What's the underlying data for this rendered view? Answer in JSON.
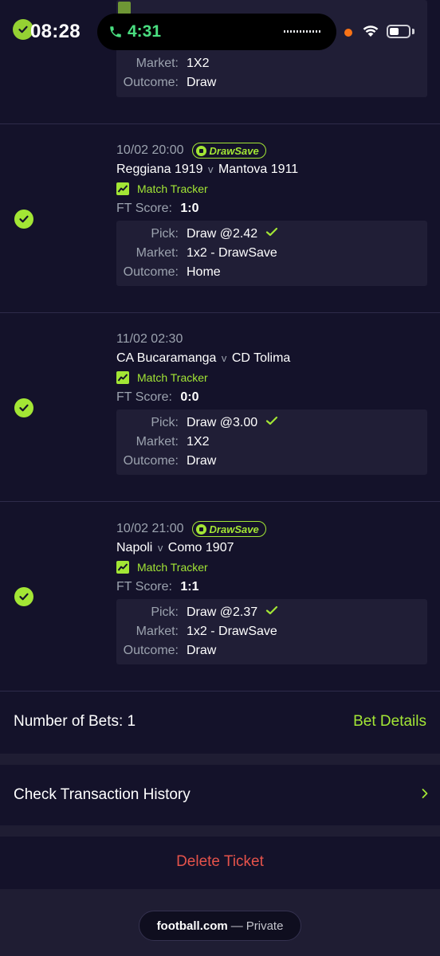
{
  "status_bar": {
    "time": "08:28",
    "call_time": "4:31"
  },
  "first_bet_partial": {
    "market_label": "Market:",
    "market_value": "1X2",
    "outcome_label": "Outcome:",
    "outcome_value": "Draw"
  },
  "bets": [
    {
      "date": "10/02 20:00",
      "has_drawsave": true,
      "drawsave_label": "DrawSave",
      "home": "Reggiana 1919",
      "vs": "v",
      "away": "Mantova 1911",
      "tracker_label": "Match Tracker",
      "score_label": "FT Score:",
      "score": "1:0",
      "pick_label": "Pick:",
      "pick": "Draw @2.42",
      "market_label": "Market:",
      "market": "1x2 - DrawSave",
      "outcome_label": "Outcome:",
      "outcome": "Home"
    },
    {
      "date": "11/02 02:30",
      "has_drawsave": false,
      "drawsave_label": "",
      "home": "CA Bucaramanga",
      "vs": "v",
      "away": "CD Tolima",
      "tracker_label": "Match Tracker",
      "score_label": "FT Score:",
      "score": "0:0",
      "pick_label": "Pick:",
      "pick": "Draw @3.00",
      "market_label": "Market:",
      "market": "1X2",
      "outcome_label": "Outcome:",
      "outcome": "Draw"
    },
    {
      "date": "10/02 21:00",
      "has_drawsave": true,
      "drawsave_label": "DrawSave",
      "home": "Napoli",
      "vs": "v",
      "away": "Como 1907",
      "tracker_label": "Match Tracker",
      "score_label": "FT Score:",
      "score": "1:1",
      "pick_label": "Pick:",
      "pick": "Draw @2.37",
      "market_label": "Market:",
      "market": "1x2 - DrawSave",
      "outcome_label": "Outcome:",
      "outcome": "Draw"
    }
  ],
  "summary": {
    "number_of_bets": "Number of Bets: 1",
    "bet_details_link": "Bet Details",
    "transaction_history": "Check Transaction History",
    "delete_ticket": "Delete Ticket"
  },
  "browser": {
    "domain": "football.com",
    "separator": "—",
    "mode": "Private"
  },
  "colors": {
    "background": "#14122a",
    "accent_green": "#a3e635",
    "delete_red": "#e5534b",
    "detail_box": "#201e36"
  }
}
